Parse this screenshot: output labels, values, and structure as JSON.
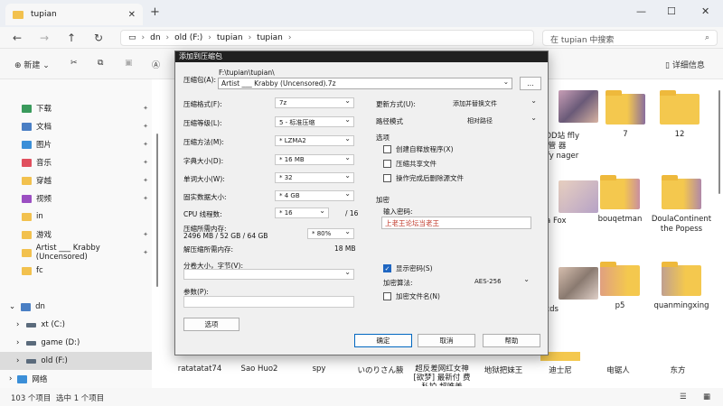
{
  "window": {
    "tab_title": "tupian",
    "new_tab": "+",
    "minimize": "—",
    "maximize": "☐",
    "close": "✕"
  },
  "address": {
    "segments": [
      "dn",
      "old (F:)",
      "tupian",
      "tupian"
    ],
    "search_placeholder": "在 tupian 中搜索"
  },
  "toolbar": {
    "new_label": "新建",
    "details_label": "详细信息"
  },
  "sidebar": {
    "quick": [
      "下载",
      "文档",
      "图片",
      "音乐",
      "穿越",
      "视频",
      "in",
      "游戏",
      "Artist ___ Krabby (Uncensored)",
      "fc"
    ],
    "root": "dn",
    "drives": [
      "xt (C:)",
      "game (D:)",
      "old (F:)"
    ],
    "network": "网络"
  },
  "status": {
    "count": "103 个项目",
    "selected": "选中 1 个项目"
  },
  "files": {
    "row1": [
      "M MOD站 ffly Mod 管 器 (Fluffy nager 50...",
      "7",
      "12"
    ],
    "row2": [
      "Asia Fox",
      "bouqetman",
      "DoulaContinent the Popess"
    ],
    "row3": [
      "oxds",
      "p5",
      "quanmingxing"
    ],
    "bottom": [
      "ratatatat74",
      "Sao Huo2",
      "spy",
      "いのりさん腋",
      "超反差网红女神 [欲梦] 最新付 费私拍 超唯美",
      "地狱把妹王",
      "迪士尼",
      "电锯人",
      "东方"
    ]
  },
  "dialog": {
    "title": "添加到压缩包",
    "archive_label": "压缩包(A):",
    "archive_path": "F:\\tupian\\tupian\\",
    "archive_name": "Artist ___ Krabby (Uncensored).7z",
    "browse": "...",
    "format_label": "压缩格式(F):",
    "format_value": "7z",
    "level_label": "压缩等级(L):",
    "level_value": "5 - 标准压缩",
    "method_label": "压缩方法(M):",
    "method_value": "* LZMA2",
    "dict_label": "字典大小(D):",
    "dict_value": "* 16 MB",
    "word_label": "单词大小(W):",
    "word_value": "* 32",
    "solid_label": "固实数据大小:",
    "solid_value": "* 4 GB",
    "cpu_label": "CPU 线程数:",
    "cpu_value": "* 16",
    "cpu_total": "/ 16",
    "mem_label": "压缩所需内存:",
    "mem_value": "2496 MB / 52 GB / 64 GB",
    "mem_percent": "* 80%",
    "decomp_label": "解压缩所需内存:",
    "decomp_value": "18 MB",
    "split_label": "分卷大小，字节(V):",
    "params_label": "参数(P):",
    "options_button": "选项",
    "update_label": "更新方式(U):",
    "update_value": "添加并替换文件",
    "pathmode_label": "路径模式",
    "pathmode_value": "相对路径",
    "options_group": "选项",
    "opt_sfx": "创建自释放程序(X)",
    "opt_shared": "压缩共享文件",
    "opt_delete": "操作完成后删除源文件",
    "encrypt_group": "加密",
    "password_label": "输入密码:",
    "password_value": "上老王论坛当老王",
    "show_password": "显示密码(S)",
    "enc_method_label": "加密算法:",
    "enc_method_value": "AES-256",
    "enc_names": "加密文件名(N)",
    "ok": "确定",
    "cancel": "取消",
    "help": "帮助"
  },
  "colors": {
    "folder": "#f4c84e",
    "accent": "#1f66c1"
  }
}
